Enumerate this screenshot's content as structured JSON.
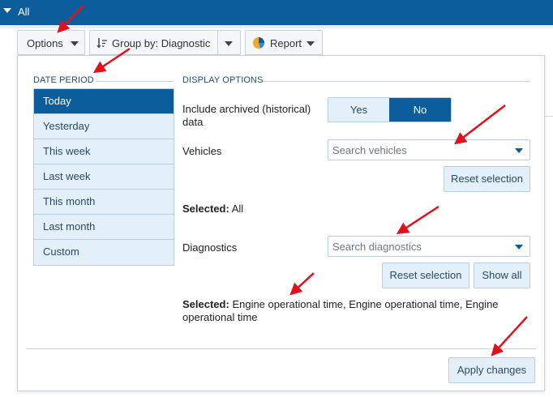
{
  "topbar": {
    "title": "All"
  },
  "toolbar": {
    "options_label": "Options",
    "groupby_label": "Group by: Diagnostic",
    "report_label": "Report"
  },
  "date_period": {
    "title": "DATE PERIOD",
    "items": [
      "Today",
      "Yesterday",
      "This week",
      "Last week",
      "This month",
      "Last month",
      "Custom"
    ],
    "active": "Today"
  },
  "display_options": {
    "title": "DISPLAY OPTIONS",
    "archived_label": "Include archived (historical) data",
    "yes_label": "Yes",
    "no_label": "No",
    "archived_value": "No",
    "vehicles_label": "Vehicles",
    "vehicles_placeholder": "Search vehicles",
    "reset_label": "Reset selection",
    "vehicles_selected_label": "Selected:",
    "vehicles_selected_value": "All",
    "diagnostics_label": "Diagnostics",
    "diagnostics_placeholder": "Search diagnostics",
    "diag_reset_label": "Reset selection",
    "show_all_label": "Show all",
    "diag_selected_label": "Selected:",
    "diag_selected_value": "Engine operational time, Engine operational time, Engine operational time"
  },
  "footer": {
    "apply_label": "Apply changes"
  },
  "colors": {
    "brand": "#0b5e9b",
    "light": "#e3f0fa",
    "annotation": "#e2101c"
  },
  "icons": [
    "caret-down-icon",
    "sort-icon",
    "pie-chart-icon",
    "chevron-down-icon",
    "annotation-arrow"
  ]
}
